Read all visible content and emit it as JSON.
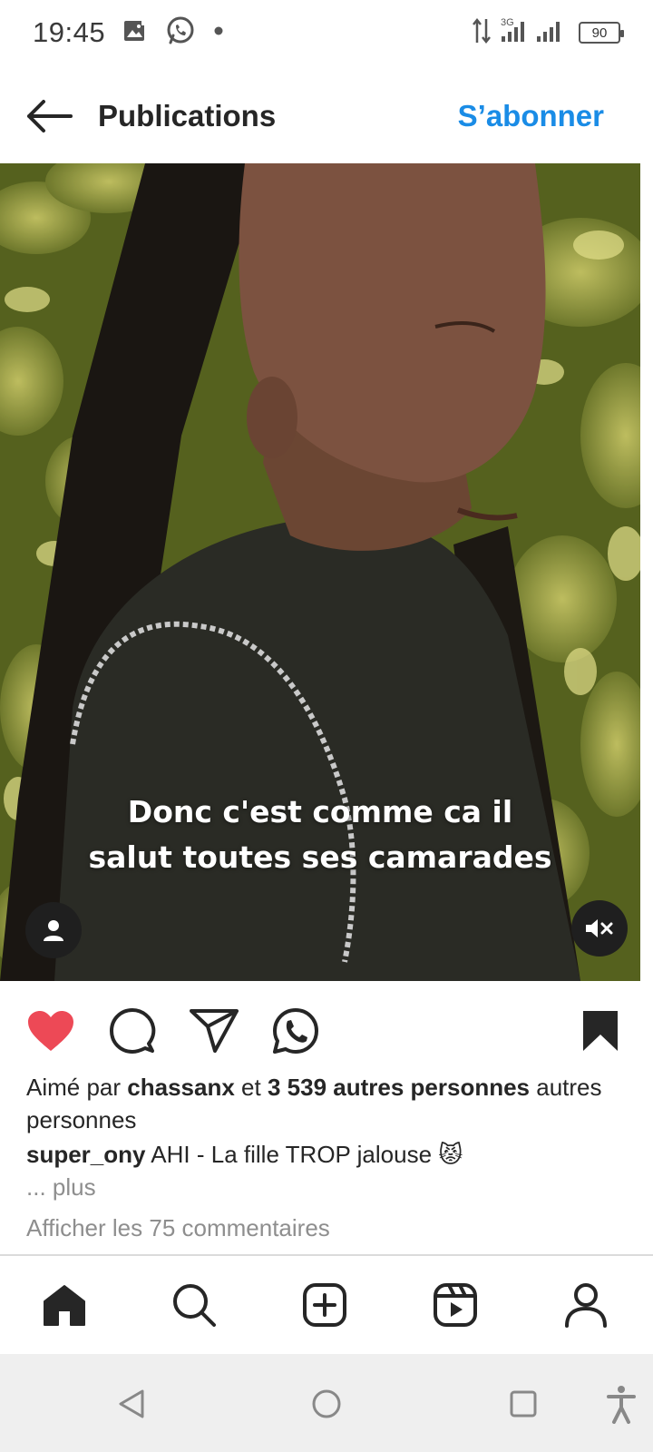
{
  "status_bar": {
    "time": "19:45",
    "network": "3G",
    "battery": "90",
    "icons": [
      "gallery-icon",
      "whatsapp-icon",
      "dot-icon",
      "data-arrows-icon",
      "signal-icon",
      "battery-icon"
    ]
  },
  "header": {
    "title": "Publications",
    "follow_label": "S’abonner"
  },
  "media": {
    "caption_line1": "Donc c'est comme ca il",
    "caption_line2": "salut toutes ses camarades"
  },
  "actions": {
    "icons": [
      "heart-icon",
      "comment-icon",
      "share-icon",
      "whatsapp-icon",
      "bookmark-icon"
    ],
    "liked": true,
    "like_color": "#ed4956"
  },
  "likes": {
    "prefix": "Aimé par",
    "user": "chassanx",
    "connector": "et",
    "count_text": "3 539 autres personnes",
    "suffix": "autres personnes"
  },
  "caption": {
    "username": "super_ony",
    "text": "AHI - La fille TROP jalouse 😾",
    "more_label": "... plus"
  },
  "comments_link": "Afficher les 75 commentaires",
  "bottom_nav": [
    "home-icon",
    "search-icon",
    "create-icon",
    "reels-icon",
    "profile-icon"
  ],
  "system_nav": [
    "back-icon",
    "home-circle-icon",
    "recents-icon",
    "accessibility-icon"
  ],
  "colors": {
    "accent_blue": "#1a8ce6",
    "text": "#262626",
    "muted": "#8e8e8e"
  }
}
